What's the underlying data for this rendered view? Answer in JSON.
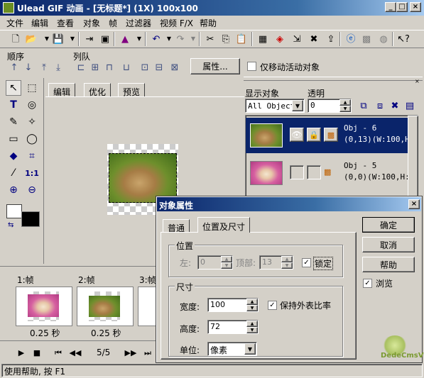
{
  "window": {
    "title": "Ulead GIF 动画 - [无标题*] (1X) 100x100"
  },
  "menu": [
    "文件",
    "编辑",
    "查看",
    "对象",
    "帧",
    "过滤器",
    "视频 F/X",
    "帮助"
  ],
  "arrange": {
    "order_label": "顺序",
    "queue_label": "列队",
    "properties_button": "属性...",
    "move_active_only": "仅移动活动对象"
  },
  "canvas_tabs": [
    "编辑",
    "优化",
    "预览"
  ],
  "object_panel": {
    "show_label": "显示对象",
    "opacity_label": "透明",
    "filter_value": "All Objects",
    "opacity_value": "0",
    "objects": [
      {
        "name": "Obj - 6",
        "info": "(0,13)(W:100,H:",
        "selected": true
      },
      {
        "name": "Obj - 5",
        "info": "(0,0)(W:100,H:",
        "selected": false
      }
    ]
  },
  "frames": {
    "items": [
      {
        "label": "1:帧",
        "delay": "0.25 秒"
      },
      {
        "label": "2:帧",
        "delay": "0.25 秒"
      },
      {
        "label": "3:帧",
        "delay": ""
      }
    ],
    "counter": "5/5"
  },
  "status": {
    "text": "使用帮助, 按 F1"
  },
  "dialog": {
    "title": "对象属性",
    "tabs": [
      "普通",
      "位置及尺寸"
    ],
    "position_group": "位置",
    "left_label": "左:",
    "left_value": "0",
    "top_label": "顶部:",
    "top_value": "13",
    "lock_label": "锁定",
    "size_group": "尺寸",
    "width_label": "宽度:",
    "width_value": "100",
    "keep_ratio_label": "保持外表比率",
    "height_label": "高度:",
    "height_value": "72",
    "unit_label": "单位:",
    "unit_value": "像素",
    "ok": "确定",
    "cancel": "取消",
    "help": "帮助",
    "browse": "浏览"
  },
  "watermark": "DedeCmsV3"
}
